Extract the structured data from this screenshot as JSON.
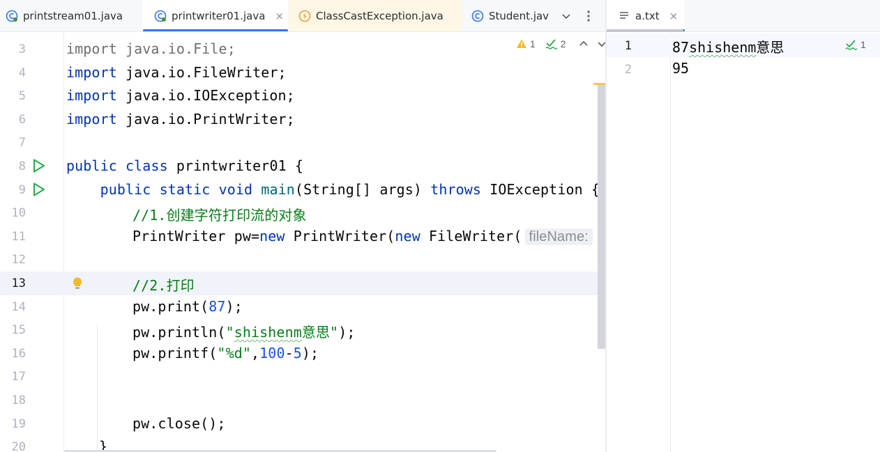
{
  "left_tabs": [
    {
      "label": "printstream01.java",
      "icon": "java-class-icon",
      "state": "inactive"
    },
    {
      "label": "printwriter01.java",
      "icon": "java-class-icon",
      "state": "active",
      "close": "×"
    },
    {
      "label": "ClassCastException.java",
      "icon": "exception-class-icon",
      "state": "modified"
    },
    {
      "label": "Student.jav",
      "icon": "class-c-icon",
      "state": "inactive"
    }
  ],
  "right_tabs": [
    {
      "label": "a.txt",
      "icon": "text-file-icon",
      "close": "×"
    }
  ],
  "inspections": {
    "warnings": "1",
    "weak_warnings": "2"
  },
  "right_inspections": {
    "ok": "1"
  },
  "left_editor": {
    "line_numbers": [
      "3",
      "4",
      "5",
      "6",
      "7",
      "8",
      "9",
      "10",
      "11",
      "12",
      "13",
      "14",
      "15",
      "16",
      "17",
      "18",
      "19",
      "20"
    ],
    "current_line": "13",
    "code": {
      "l3_kw": "import",
      "l3_rest": " java.io.File;",
      "l4_kw": "import",
      "l4_rest": " java.io.FileWriter;",
      "l5_kw": "import",
      "l5_rest": " java.io.IOException;",
      "l6_kw": "import",
      "l6_rest": " java.io.PrintWriter;",
      "l8_kw1": "public",
      "l8_kw2": "class",
      "l8_name": "printwriter01",
      "l8_rest": " {",
      "l9_indent": "    ",
      "l9_kw1": "public",
      "l9_kw2": "static",
      "l9_kw3": "void",
      "l9_name": "main",
      "l9_mid": "(String[] args) ",
      "l9_kw4": "throws",
      "l9_rest": " IOException {",
      "l10_comment": "//1.创建字符打印流的对象",
      "l11_a": "PrintWriter pw=",
      "l11_new1": "new",
      "l11_b": " PrintWriter(",
      "l11_new2": "new",
      "l11_c": " FileWriter(",
      "l11_hint": "fileName:",
      "l11_d": "\"",
      "l13_comment": "//2.打印",
      "l14_a": "pw.print(",
      "l14_num": "87",
      "l14_b": ");",
      "l15_a": "pw.println(",
      "l15_str_q1": "\"",
      "l15_str_word": "shishenm",
      "l15_str_rest": "意思\"",
      "l15_b": ");",
      "l16_a": "pw.printf(",
      "l16_str": "\"%d\"",
      "l16_comma": ",",
      "l16_n1": "100",
      "l16_dash": "-",
      "l16_n2": "5",
      "l16_b": ");",
      "l19_a": "pw.close();",
      "l20_a": "}"
    }
  },
  "right_editor": {
    "line_numbers": [
      "1",
      "2"
    ],
    "lines": [
      "87shishenm意思",
      "95"
    ],
    "line1_wavy": "shishenm",
    "line1_pre": "87",
    "line1_post": "意思"
  },
  "colors": {
    "keyword": "#0033b3",
    "string": "#067d17",
    "number": "#1750eb",
    "accent": "#3574f0",
    "run": "#2aa84a"
  }
}
